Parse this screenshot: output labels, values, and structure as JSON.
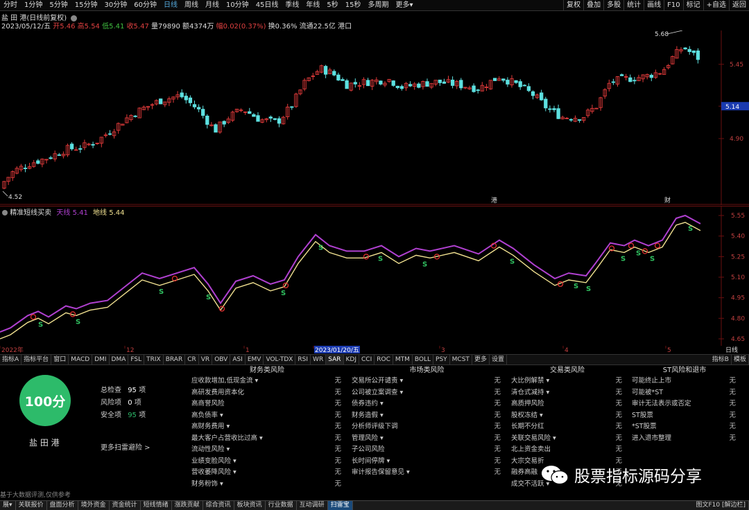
{
  "toolbar": {
    "left_items": [
      "分时",
      "1分钟",
      "5分钟",
      "15分钟",
      "30分钟",
      "60分钟",
      "日线",
      "周线",
      "月线",
      "10分钟",
      "45日线",
      "季线",
      "年线",
      "5秒",
      "15秒",
      "多周期",
      "更多▾"
    ],
    "active_item": "日线",
    "right_items": [
      "复权",
      "叠加",
      "多股",
      "统计",
      "画线",
      "F10",
      "标记",
      "+自选",
      "返回"
    ]
  },
  "stock": {
    "name_line": "盐 田 港(日线前复权)",
    "date": "2023/05/12/五",
    "open_label": "开5.46",
    "high_label": "高5.54",
    "low_label": "低5.41",
    "close_label": "收5.47",
    "volume_label": "量79890",
    "amount_label": "额4374万",
    "change_label": "幅0.02(0.37%)",
    "turnover_label": "换0.36%",
    "float_label": "流通22.5亿",
    "name_short": "港口"
  },
  "main_chart": {
    "y_ticks": [
      "5.45",
      "5.14",
      "4.90"
    ],
    "current_price_tag": "5.14",
    "max_marker": "5.68",
    "min_marker": "4.52",
    "event_markers": [
      "港",
      "财"
    ],
    "colors": {
      "up": "#e03a3a",
      "down": "#5de0e0",
      "grid": "#6a1010",
      "tag": "#1a3ab0"
    }
  },
  "indicator": {
    "title": "精准短线买卖",
    "line1_label": "天线",
    "line1_value": "5.41",
    "line2_label": "地线",
    "line2_value": "5.44",
    "y_ticks": [
      "5.55",
      "5.40",
      "5.25",
      "5.10",
      "4.95",
      "4.80",
      "4.65"
    ],
    "signal_label": "S",
    "colors": {
      "line1": "#b040d0",
      "line2": "#f0e090",
      "signal": "#30c060",
      "buy": "#e03030"
    }
  },
  "date_axis": {
    "labels": [
      "2022年",
      "12",
      "1",
      "2023/01/20/五",
      "3",
      "4",
      "5"
    ],
    "period": "日线"
  },
  "tabs": {
    "items": [
      "指标A",
      "指标平台",
      "窗口",
      "MACD",
      "DMI",
      "DMA",
      "FSL",
      "TRIX",
      "BRAR",
      "CR",
      "VR",
      "OBV",
      "ASI",
      "EMV",
      "VOL-TDX",
      "RSI",
      "WR",
      "SAR",
      "KDJ",
      "CCI",
      "ROC",
      "MTM",
      "BOLL",
      "PSY",
      "MCST",
      "更多",
      "设置"
    ],
    "selected": "SAR",
    "right_items": [
      "指标B",
      "模板"
    ]
  },
  "risk_summary": {
    "score": "100分",
    "name": "盐 田 港",
    "total_label": "总检查",
    "total_value": "95",
    "total_unit": "项",
    "risk_label": "风险项",
    "risk_value": "0",
    "risk_unit": "项",
    "safe_label": "安全项",
    "safe_value": "95",
    "safe_unit": "项",
    "more_link": "更多扫雷避险 >",
    "footnote": "基于大数据评测,仅供参考"
  },
  "risk_columns": [
    {
      "title": "财务类风险",
      "rows": [
        [
          "应收款增加,低现金流 ▾",
          "无"
        ],
        [
          "高研发费用资本化",
          "无"
        ],
        [
          "高商誉风险",
          "无"
        ],
        [
          "高负债率 ▾",
          "无"
        ],
        [
          "高财务费用 ▾",
          "无"
        ],
        [
          "最大客户占营收比过高 ▾",
          "无"
        ],
        [
          "流动性风险 ▾",
          "无"
        ],
        [
          "业绩变脸风险 ▾",
          "无"
        ],
        [
          "营收萎降风险 ▾",
          "无"
        ],
        [
          "财务粉饰 ▾",
          "无"
        ]
      ]
    },
    {
      "title": "市场类风险",
      "rows": [
        [
          "交易所公开谴责 ▾",
          "无"
        ],
        [
          "公司被立案调查 ▾",
          "无"
        ],
        [
          "债券违约 ▾",
          "无"
        ],
        [
          "财务造假 ▾",
          "无"
        ],
        [
          "分析师评级下调",
          "无"
        ],
        [
          "管理风险 ▾",
          "无"
        ],
        [
          "子公司风险",
          "无"
        ],
        [
          "长时间停牌 ▾",
          "无"
        ],
        [
          "审计报告保留意见 ▾",
          "无"
        ]
      ]
    },
    {
      "title": "交易类风险",
      "rows": [
        [
          "大比例解禁 ▾",
          "无"
        ],
        [
          "清仓式减持 ▾",
          "无"
        ],
        [
          "高质押风险",
          "无"
        ],
        [
          "股权冻结 ▾",
          "无"
        ],
        [
          "长期不分红",
          "无"
        ],
        [
          "关联交易风险 ▾",
          "无"
        ],
        [
          "北上资金卖出",
          "无"
        ],
        [
          "大宗交易折",
          "无"
        ],
        [
          "融券高融",
          "无"
        ],
        [
          "成交不活跃 ▾",
          "无"
        ]
      ]
    },
    {
      "title": "ST风险和退市",
      "rows": [
        [
          "可能终止上市",
          "无"
        ],
        [
          "可能被*ST",
          "无"
        ],
        [
          "审计无法表示或否定",
          "无"
        ],
        [
          "ST股票",
          "无"
        ],
        [
          "*ST股票",
          "无"
        ],
        [
          "进入退市整理",
          "无"
        ]
      ]
    }
  ],
  "watermark": {
    "text": "股票指标源码分享"
  },
  "statusbar": {
    "items": [
      "展▾",
      "关联报价",
      "盘面分析",
      "境外资金",
      "资金统计",
      "短线情绪",
      "涨跌贡献",
      "综合资讯",
      "板块资讯",
      "行业数据",
      "互动调研",
      "扫雷宝"
    ],
    "selected": "扫雷宝",
    "right_item": "图文F10 [解边栏]"
  }
}
